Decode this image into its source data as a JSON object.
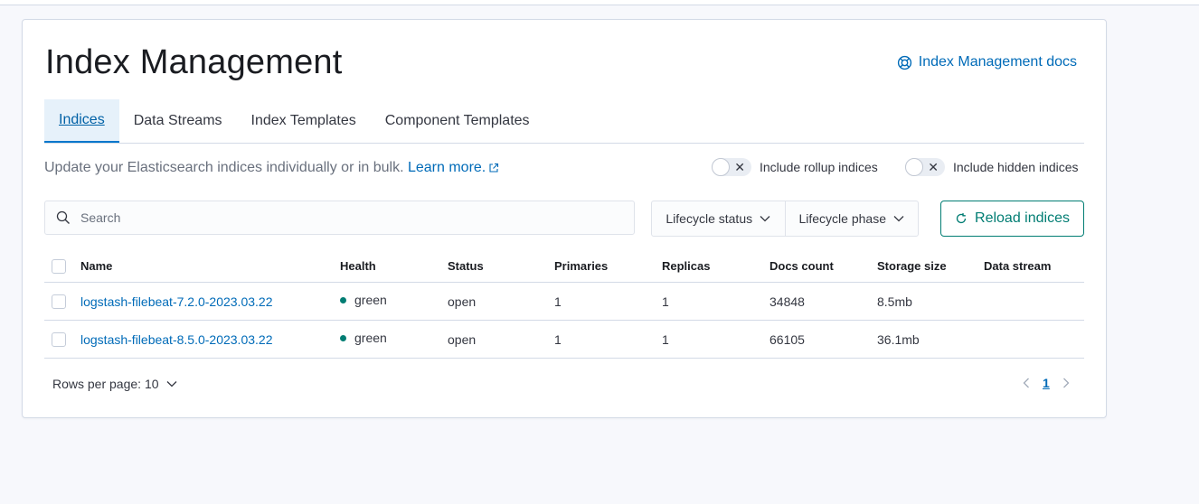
{
  "page": {
    "title": "Index Management",
    "docs_link": "Index Management docs"
  },
  "tabs": [
    {
      "label": "Indices",
      "active": true
    },
    {
      "label": "Data Streams",
      "active": false
    },
    {
      "label": "Index Templates",
      "active": false
    },
    {
      "label": "Component Templates",
      "active": false
    }
  ],
  "description": {
    "text": "Update your Elasticsearch indices individually or in bulk.",
    "link": "Learn more."
  },
  "toggles": {
    "rollup": {
      "label": "Include rollup indices",
      "on": false
    },
    "hidden": {
      "label": "Include hidden indices",
      "on": false
    }
  },
  "search": {
    "placeholder": "Search",
    "value": ""
  },
  "filters": {
    "lifecycle_status": "Lifecycle status",
    "lifecycle_phase": "Lifecycle phase"
  },
  "reload_label": "Reload indices",
  "table": {
    "columns": [
      "Name",
      "Health",
      "Status",
      "Primaries",
      "Replicas",
      "Docs count",
      "Storage size",
      "Data stream"
    ],
    "rows": [
      {
        "name": "logstash-filebeat-7.2.0-2023.03.22",
        "health": "green",
        "status": "open",
        "primaries": "1",
        "replicas": "1",
        "docs_count": "34848",
        "storage_size": "8.5mb",
        "data_stream": ""
      },
      {
        "name": "logstash-filebeat-8.5.0-2023.03.22",
        "health": "green",
        "status": "open",
        "primaries": "1",
        "replicas": "1",
        "docs_count": "66105",
        "storage_size": "36.1mb",
        "data_stream": ""
      }
    ]
  },
  "pagination": {
    "rows_per_page": "Rows per page: 10",
    "current_page": "1"
  },
  "colors": {
    "accent": "#006bb8",
    "success": "#017d73",
    "tab_active_bg": "#e6f1fa"
  }
}
